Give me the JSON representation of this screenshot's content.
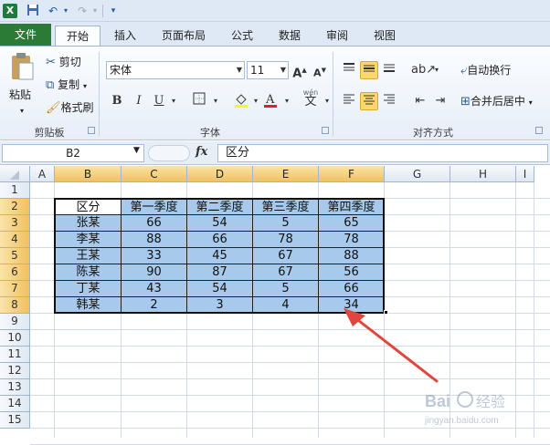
{
  "qat": {
    "icons": [
      "excel-icon",
      "save-icon",
      "undo-icon",
      "redo-icon",
      "customize-icon"
    ]
  },
  "tabs": [
    "文件",
    "开始",
    "插入",
    "页面布局",
    "公式",
    "数据",
    "审阅",
    "视图"
  ],
  "ribbon": {
    "clipboard": {
      "paste": "粘贴",
      "cut": "剪切",
      "copy": "复制",
      "format_painter": "格式刷",
      "group": "剪贴板"
    },
    "font": {
      "name": "宋体",
      "size": "11",
      "bold": "B",
      "italic": "I",
      "underline": "U",
      "group": "字体"
    },
    "alignment": {
      "wrap": "自动换行",
      "merge": "合并后居中",
      "group": "对齐方式"
    }
  },
  "formula_bar": {
    "name_box": "B2",
    "fx": "fx",
    "content": "区分"
  },
  "grid": {
    "columns": [
      "A",
      "B",
      "C",
      "D",
      "E",
      "F",
      "G",
      "H",
      "I"
    ],
    "rows": [
      "1",
      "2",
      "3",
      "4",
      "5",
      "6",
      "7",
      "8",
      "9",
      "10",
      "11",
      "12",
      "13",
      "14",
      "15"
    ],
    "header": [
      "区分",
      "第一季度",
      "第二季度",
      "第三季度",
      "第四季度"
    ],
    "data": [
      [
        "张某",
        "66",
        "54",
        "5",
        "65"
      ],
      [
        "李某",
        "88",
        "66",
        "78",
        "78"
      ],
      [
        "王某",
        "33",
        "45",
        "67",
        "88"
      ],
      [
        "陈某",
        "90",
        "87",
        "67",
        "56"
      ],
      [
        "丁某",
        "43",
        "54",
        "5",
        "66"
      ],
      [
        "韩某",
        "2",
        "3",
        "4",
        "34"
      ]
    ]
  },
  "colors": {
    "selection": "#a7caec",
    "arrow": "#e0463c",
    "file_tab": "#2b7a36"
  }
}
